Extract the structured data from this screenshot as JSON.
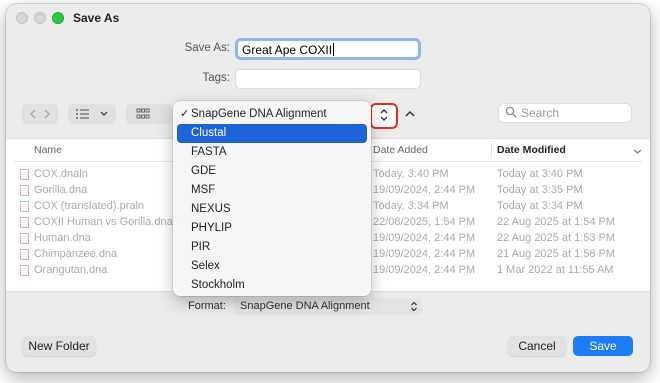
{
  "window": {
    "title": "Save As"
  },
  "form": {
    "save_as_label": "Save As:",
    "save_as_value": "Great Ape COXII",
    "tags_label": "Tags:",
    "tags_value": ""
  },
  "toolbar": {
    "search_placeholder": "Search"
  },
  "columns": {
    "name": "Name",
    "date_added": "Date Added",
    "date_modified": "Date Modified"
  },
  "files": [
    {
      "name": "COX.dnaln",
      "added": "Today, 3:40 PM",
      "modified": "Today at 3:40 PM",
      "icon": "red"
    },
    {
      "name": "Gorilla.dna",
      "added": "19/09/2024, 2:44 PM",
      "modified": "Today at 3:35 PM",
      "icon": "red"
    },
    {
      "name": "COX (translated).praln",
      "added": "Today, 3:34 PM",
      "modified": "Today at 3:34 PM",
      "icon": "blue"
    },
    {
      "name": "COXII Human vs Gorilla.dnaln",
      "added": "22/08/2025, 1:54 PM",
      "modified": "22 Aug 2025 at 1:54 PM",
      "icon": "red"
    },
    {
      "name": "Human.dna",
      "added": "19/09/2024, 2:44 PM",
      "modified": "22 Aug 2025 at 1:53 PM",
      "icon": "red"
    },
    {
      "name": "Chimpanzee.dna",
      "added": "19/09/2024, 2:44 PM",
      "modified": "21 Aug 2025 at 1:58 PM",
      "icon": "red"
    },
    {
      "name": "Orangutan.dna",
      "added": "19/09/2024, 2:44 PM",
      "modified": "1 Mar 2022 at 11:55 AM",
      "icon": "red"
    }
  ],
  "format": {
    "label": "Format:",
    "selected": "SnapGene DNA Alignment"
  },
  "menu": {
    "items": [
      {
        "label": "SnapGene DNA Alignment",
        "checked": true
      },
      {
        "label": "Clustal",
        "highlighted": true
      },
      {
        "label": "FASTA"
      },
      {
        "label": "GDE"
      },
      {
        "label": "MSF"
      },
      {
        "label": "NEXUS"
      },
      {
        "label": "PHYLIP"
      },
      {
        "label": "PIR"
      },
      {
        "label": "Selex"
      },
      {
        "label": "Stockholm"
      }
    ],
    "check_glyph": "✓"
  },
  "buttons": {
    "new_folder": "New Folder",
    "cancel": "Cancel",
    "save": "Save"
  },
  "colors": {
    "accent": "#1e7cf6",
    "highlight_ring": "#e2311d",
    "menu_highlight": "#1f63d8"
  }
}
